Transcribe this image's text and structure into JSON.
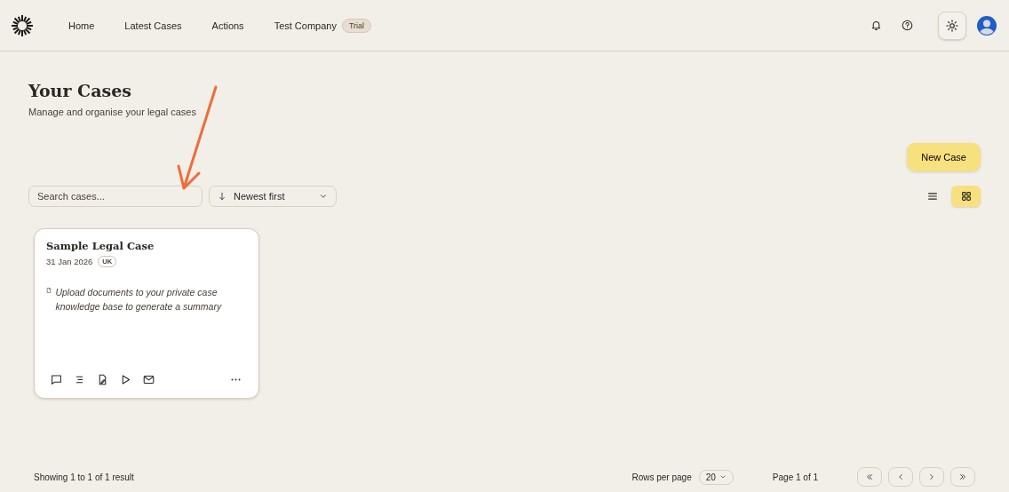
{
  "nav": {
    "items": [
      {
        "label": "Home"
      },
      {
        "label": "Latest Cases"
      },
      {
        "label": "Actions"
      }
    ],
    "company": {
      "name": "Test Company",
      "badge": "Trial"
    }
  },
  "page": {
    "title": "Your Cases",
    "subtitle": "Manage and organise your legal cases",
    "new_button": "New Case"
  },
  "search": {
    "placeholder": "Search cases..."
  },
  "sort": {
    "label": "Newest first"
  },
  "view_toggle": [
    {
      "kind": "list",
      "selected": false
    },
    {
      "kind": "grid",
      "selected": true
    }
  ],
  "cases": [
    {
      "title": "Sample Legal Case",
      "date": "31 Jan 2026",
      "region": "UK",
      "summary": "Upload documents to your private case knowledge base to generate a summary"
    }
  ],
  "footer": {
    "showing": "Showing 1 to 1 of 1 result",
    "rows_label": "Rows per page",
    "rows_value": "20",
    "page": "Page 1 of 1"
  }
}
